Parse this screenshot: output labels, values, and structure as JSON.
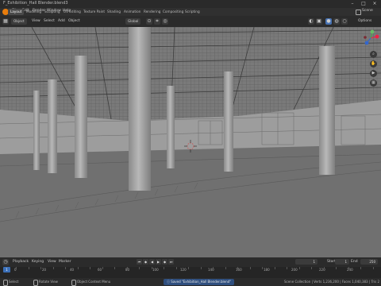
{
  "app": {
    "title": "F_Exhibition_Hall Blender.blend3",
    "window_controls": [
      "–",
      "□",
      "×"
    ]
  },
  "menu": [
    "File",
    "Edit",
    "Render",
    "Window",
    "Help"
  ],
  "workspaces": [
    "Layout",
    "Modeling",
    "Sculpting",
    "UV Editing",
    "Texture Paint",
    "Shading",
    "Animation",
    "Rendering",
    "Compositing",
    "Scripting"
  ],
  "scene": {
    "label": "Scene"
  },
  "header": {
    "mode": "Object",
    "menus": [
      "View",
      "Select",
      "Add",
      "Object"
    ],
    "orientation": "Global",
    "options_label": "Options"
  },
  "timeline": {
    "menus": [
      "Playback",
      "Keying",
      "View",
      "Marker"
    ],
    "current_frame": "1",
    "start_label": "Start",
    "start": "1",
    "end_label": "End",
    "end": "250",
    "ruler": [
      "0",
      "20",
      "40",
      "60",
      "80",
      "100",
      "120",
      "140",
      "160",
      "180",
      "200",
      "220",
      "240"
    ],
    "playhead": "1"
  },
  "status": {
    "left": "Select",
    "middle": "Rotate View",
    "context": "Object Context Menu",
    "notice": "Saved \"Exhibition_Hall Blender.blend\"",
    "right": "Scene Collection | Verts 1,236,200 | Faces 1,040,383 | Tris 2"
  },
  "colors": {
    "accent": "#4772b3",
    "floor": "#6f6f6f",
    "wall": "#9c9c9c",
    "ceiling": "#7b7b7b",
    "pillar": "#a8a8a8"
  }
}
